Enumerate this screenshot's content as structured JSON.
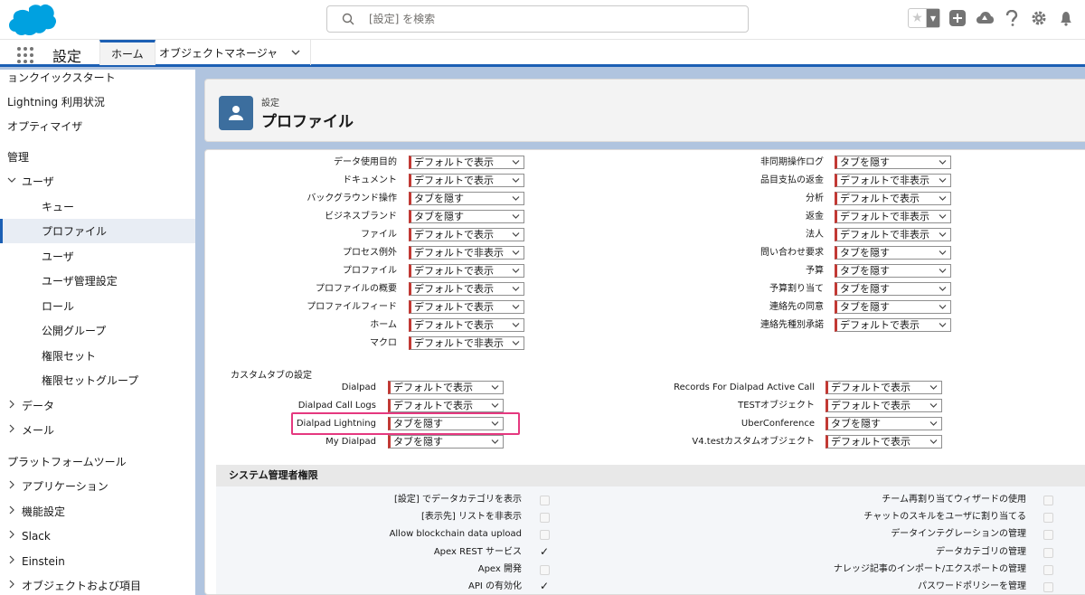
{
  "header": {
    "search_placeholder": "[設定] を検索"
  },
  "nav": {
    "app_name": "設定",
    "tab_home": "ホーム",
    "tab_object_manager": "オブジェクトマネージャ"
  },
  "sidebar": {
    "items": [
      {
        "label": "ョンクイックスタート",
        "level": 0
      },
      {
        "label": "Lightning 利用状況",
        "level": 0
      },
      {
        "label": "オプティマイザ",
        "level": 0
      },
      {
        "label": "管理",
        "level": 0
      },
      {
        "label": "ユーザ",
        "level": 1,
        "caret": "expanded"
      },
      {
        "label": "キュー",
        "level": 2
      },
      {
        "label": "プロファイル",
        "level": 2,
        "active": true
      },
      {
        "label": "ユーザ",
        "level": 2
      },
      {
        "label": "ユーザ管理設定",
        "level": 2
      },
      {
        "label": "ロール",
        "level": 2
      },
      {
        "label": "公開グループ",
        "level": 2
      },
      {
        "label": "権限セット",
        "level": 2
      },
      {
        "label": "権限セットグループ",
        "level": 2
      },
      {
        "label": "データ",
        "level": 1,
        "caret": "collapsed"
      },
      {
        "label": "メール",
        "level": 1,
        "caret": "collapsed"
      },
      {
        "label": "プラットフォームツール",
        "level": 0
      },
      {
        "label": "アプリケーション",
        "level": 1,
        "caret": "collapsed"
      },
      {
        "label": "機能設定",
        "level": 1,
        "caret": "collapsed"
      },
      {
        "label": "Slack",
        "level": 1,
        "caret": "collapsed"
      },
      {
        "label": "Einstein",
        "level": 1,
        "caret": "collapsed"
      },
      {
        "label": "オブジェクトおよび項目",
        "level": 1,
        "caret": "collapsed"
      }
    ]
  },
  "page_header": {
    "breadcrumb": "設定",
    "title": "プロファイル"
  },
  "standard_tabs": {
    "left": [
      {
        "label": "データ使用目的",
        "value": "デフォルトで表示"
      },
      {
        "label": "ドキュメント",
        "value": "デフォルトで表示"
      },
      {
        "label": "バックグラウンド操作",
        "value": "タブを隠す"
      },
      {
        "label": "ビジネスブランド",
        "value": "タブを隠す"
      },
      {
        "label": "ファイル",
        "value": "デフォルトで表示"
      },
      {
        "label": "プロセス例外",
        "value": "デフォルトで非表示"
      },
      {
        "label": "プロファイル",
        "value": "デフォルトで表示"
      },
      {
        "label": "プロファイルの概要",
        "value": "デフォルトで表示"
      },
      {
        "label": "プロファイルフィード",
        "value": "デフォルトで表示"
      },
      {
        "label": "ホーム",
        "value": "デフォルトで表示"
      },
      {
        "label": "マクロ",
        "value": "デフォルトで非表示"
      }
    ],
    "right": [
      {
        "label": "非同期操作ログ",
        "value": "タブを隠す"
      },
      {
        "label": "品目支払の返金",
        "value": "デフォルトで非表示"
      },
      {
        "label": "分析",
        "value": "デフォルトで表示"
      },
      {
        "label": "返金",
        "value": "デフォルトで非表示"
      },
      {
        "label": "法人",
        "value": "デフォルトで非表示"
      },
      {
        "label": "問い合わせ要求",
        "value": "タブを隠す"
      },
      {
        "label": "予算",
        "value": "タブを隠す"
      },
      {
        "label": "予算割り当て",
        "value": "タブを隠す"
      },
      {
        "label": "連絡先の同意",
        "value": "タブを隠す"
      },
      {
        "label": "連絡先種別承諾",
        "value": "デフォルトで表示"
      }
    ]
  },
  "custom_tabs": {
    "heading": "カスタムタブの設定",
    "left": [
      {
        "label": "Dialpad",
        "value": "デフォルトで表示"
      },
      {
        "label": "Dialpad Call Logs",
        "value": "デフォルトで表示"
      },
      {
        "label": "Dialpad Lightning",
        "value": "タブを隠す",
        "highlighted": true
      },
      {
        "label": "My Dialpad",
        "value": "タブを隠す"
      }
    ],
    "right": [
      {
        "label": "Records For Dialpad Active Call",
        "value": "デフォルトで表示"
      },
      {
        "label": "TESTオブジェクト",
        "value": "デフォルトで表示"
      },
      {
        "label": "UberConference",
        "value": "タブを隠す"
      },
      {
        "label": "V4.testカスタムオブジェクト",
        "value": "デフォルトで表示"
      }
    ]
  },
  "admin_permissions": {
    "heading": "システム管理者権限",
    "left": [
      {
        "label": "[設定] でデータカテゴリを表示",
        "checked": false
      },
      {
        "label": "[表示先] リストを非表示",
        "checked": false
      },
      {
        "label": "Allow blockchain data upload",
        "checked": false
      },
      {
        "label": "Apex REST サービス",
        "checked": true
      },
      {
        "label": "Apex 開発",
        "checked": false
      },
      {
        "label": "API の有効化",
        "checked": true
      }
    ],
    "right": [
      {
        "label": "チーム再割り当てウィザードの使用",
        "checked": false
      },
      {
        "label": "チャットのスキルをユーザに割り当てる",
        "checked": false
      },
      {
        "label": "データインテグレーションの管理",
        "checked": false
      },
      {
        "label": "データカテゴリの管理",
        "checked": false
      },
      {
        "label": "ナレッジ記事のインポート/エクスポートの管理",
        "checked": false
      },
      {
        "label": "パスワードポリシーを管理",
        "checked": false
      }
    ]
  },
  "checkmark_glyph": "✓",
  "colors": {
    "accent": "#1b5fb4",
    "required_bar": "#c23934",
    "highlight": "#e5387f",
    "logo": "#00a1e0"
  }
}
